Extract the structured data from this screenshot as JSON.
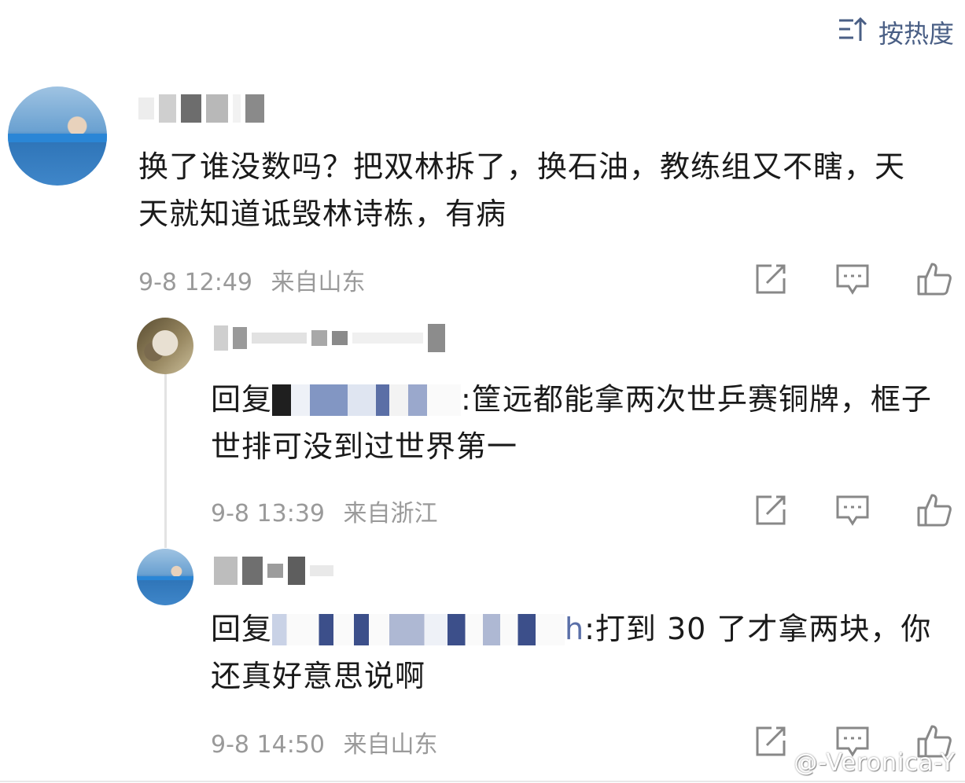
{
  "header": {
    "sort_label": "按热度",
    "sort_icon": "sort-icon"
  },
  "comments": [
    {
      "text": "换了谁没数吗？把双林拆了，换石油，教练组又不瞎，天天就知道诋毁林诗栋，有病",
      "timestamp": "9-8 12:49",
      "location": "来自山东"
    },
    {
      "reply_prefix": "回复",
      "text": ":筐远都能拿两次世乒赛铜牌，框子世排可没到过世界第一",
      "timestamp": "9-8 13:39",
      "location": "来自浙江"
    },
    {
      "reply_prefix": "回复",
      "mention_suffix": "h",
      "text": ":打到 30 了才拿两块，你还真好意思说啊",
      "timestamp": "9-8 14:50",
      "location": "来自山东"
    }
  ],
  "actions": [
    "share-icon",
    "comment-icon",
    "like-icon"
  ],
  "watermark": "@-Veronica-Y",
  "colors": {
    "accent": "#4a5f85",
    "meta": "#9a9a9a",
    "text": "#1a1a1a"
  }
}
